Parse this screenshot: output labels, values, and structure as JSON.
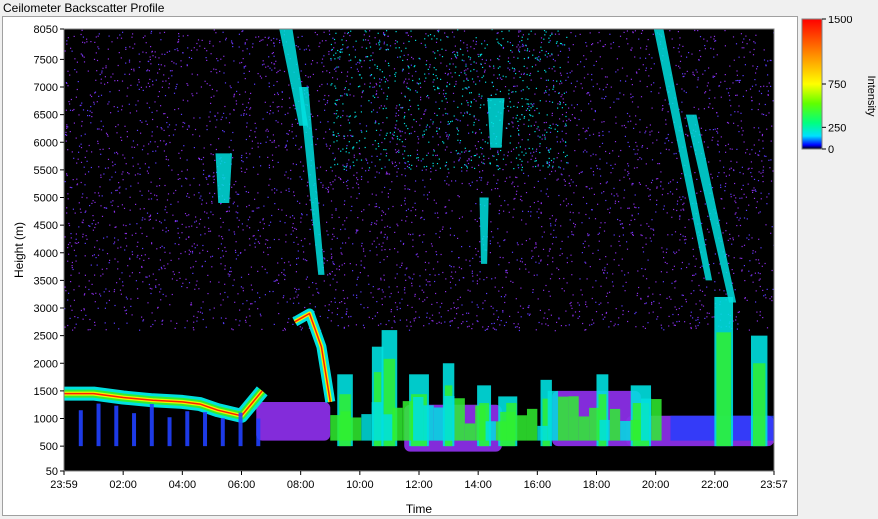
{
  "window": {
    "title": "Ceilometer Backscatter Profile"
  },
  "chart_data": {
    "type": "heatmap",
    "title": "Ceilometer Backscatter Profile",
    "xlabel": "Time",
    "ylabel": "Height (m)",
    "colorbar_label": "Intensity",
    "x_tick_labels": [
      "23:59",
      "02:00",
      "04:00",
      "06:00",
      "08:00",
      "10:00",
      "12:00",
      "14:00",
      "16:00",
      "18:00",
      "20:00",
      "22:00",
      "23:57"
    ],
    "x_tick_hours": [
      0,
      2,
      4,
      6,
      8,
      10,
      12,
      14,
      16,
      18,
      20,
      22,
      24
    ],
    "xlim_hours": [
      0,
      24
    ],
    "y_ticks": [
      50,
      500,
      1000,
      1500,
      2000,
      2500,
      3000,
      3500,
      4000,
      4500,
      5000,
      5500,
      6000,
      6500,
      7000,
      7500,
      8050
    ],
    "ylim": [
      50,
      8050
    ],
    "colorbar_ticks": [
      0,
      250,
      750,
      1500
    ],
    "colorbar_range": [
      0,
      1500
    ],
    "colors": {
      "background": "#000000",
      "noise": "#8a2ee6",
      "noise_light": "#5a3cff",
      "blue": "#2040ff",
      "cyan": "#00e0e0",
      "green": "#30f030",
      "yellow": "#f0f000",
      "red": "#ff2000"
    },
    "features": {
      "boundary_layer_top": [
        {
          "hour": 0.0,
          "height": 1450
        },
        {
          "hour": 1.0,
          "height": 1450
        },
        {
          "hour": 2.0,
          "height": 1380
        },
        {
          "hour": 3.0,
          "height": 1330
        },
        {
          "hour": 4.0,
          "height": 1300
        },
        {
          "hour": 4.6,
          "height": 1260
        },
        {
          "hour": 5.2,
          "height": 1150
        },
        {
          "hour": 6.0,
          "height": 1050
        },
        {
          "hour": 6.7,
          "height": 1500
        }
      ],
      "elevated_layer": [
        {
          "hour": 7.8,
          "height": 2750
        },
        {
          "hour": 8.3,
          "height": 2900
        },
        {
          "hour": 8.7,
          "height": 2300
        },
        {
          "hour": 9.0,
          "height": 1300
        }
      ],
      "low_cloud_columns": [
        {
          "hour": 9.5,
          "top": 1800
        },
        {
          "hour": 10.6,
          "top": 2300
        },
        {
          "hour": 11.0,
          "top": 2600
        },
        {
          "hour": 12.0,
          "top": 1800
        },
        {
          "hour": 13.0,
          "top": 2000
        },
        {
          "hour": 14.2,
          "top": 1600
        },
        {
          "hour": 15.0,
          "top": 1400
        },
        {
          "hour": 16.3,
          "top": 1700
        },
        {
          "hour": 18.2,
          "top": 1800
        },
        {
          "hour": 19.5,
          "top": 1600
        },
        {
          "hour": 22.3,
          "top": 3200
        },
        {
          "hour": 23.5,
          "top": 2500
        }
      ],
      "fall_streaks": [
        {
          "hour_top": 7.5,
          "height_top": 8050,
          "hour_bottom": 8.1,
          "height_bottom": 6300
        },
        {
          "hour_top": 8.1,
          "height_top": 7000,
          "hour_bottom": 8.7,
          "height_bottom": 3600
        },
        {
          "hour_top": 20.1,
          "height_top": 8050,
          "hour_bottom": 21.8,
          "height_bottom": 3500
        },
        {
          "hour_top": 21.2,
          "height_top": 6500,
          "hour_bottom": 22.6,
          "height_bottom": 3100
        },
        {
          "hour_top": 14.2,
          "height_top": 5000,
          "hour_bottom": 14.2,
          "height_bottom": 3800
        },
        {
          "hour_top": 14.6,
          "height_top": 6800,
          "hour_bottom": 14.6,
          "height_bottom": 5900
        },
        {
          "hour_top": 5.4,
          "height_top": 5800,
          "hour_bottom": 5.4,
          "height_bottom": 4900
        }
      ]
    }
  }
}
